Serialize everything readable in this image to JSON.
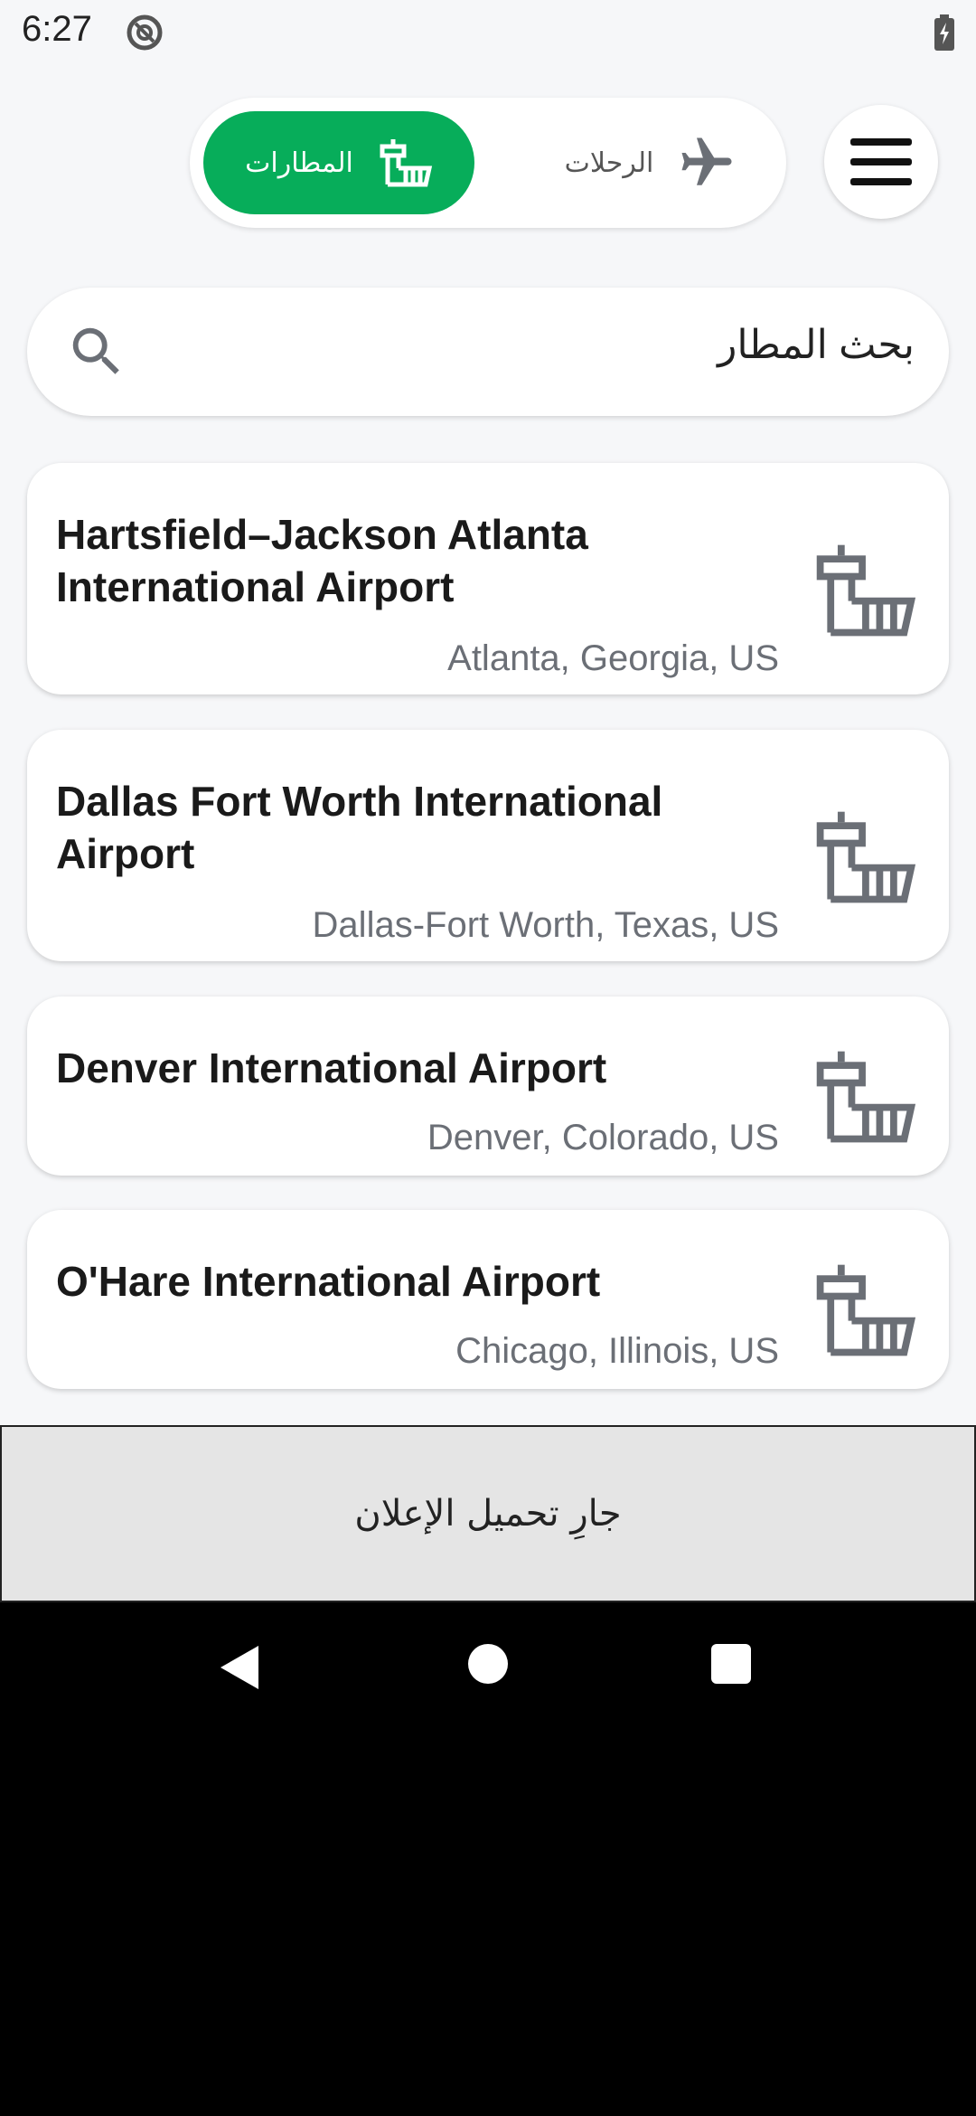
{
  "status_bar": {
    "time": "6:27"
  },
  "toggle": {
    "airports_label": "المطارات",
    "flights_label": "الرحلات"
  },
  "search": {
    "text": "بحث المطار"
  },
  "airports": [
    {
      "name": "Hartsfield–Jackson Atlanta International Airport",
      "location": "Atlanta, Georgia, US"
    },
    {
      "name": "Dallas Fort Worth International Airport",
      "location": "Dallas-Fort Worth, Texas, US"
    },
    {
      "name": "Denver International Airport",
      "location": "Denver, Colorado, US"
    },
    {
      "name": "O'Hare International Airport",
      "location": "Chicago, Illinois, US"
    }
  ],
  "ad": {
    "text": "جارِ تحميل الإعلان"
  },
  "colors": {
    "accent": "#07ad5a",
    "icon_gray": "#6b6f76"
  }
}
